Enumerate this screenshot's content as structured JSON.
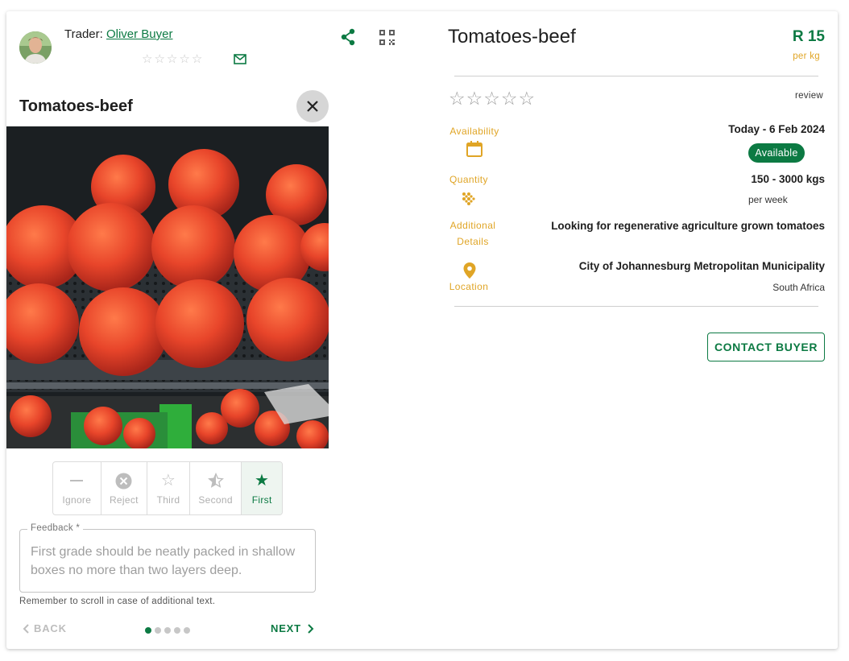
{
  "trader": {
    "prefix": "Trader:",
    "name": "Oliver Buyer"
  },
  "header_icons": [
    "share-icon",
    "qr-code-icon"
  ],
  "left_panel": {
    "product_title": "Tomatoes-beef",
    "grades": [
      {
        "label": "Ignore",
        "icon": "minus-icon"
      },
      {
        "label": "Reject",
        "icon": "reject-circle-icon"
      },
      {
        "label": "Third",
        "icon": "star-outline-icon"
      },
      {
        "label": "Second",
        "icon": "star-half-icon"
      },
      {
        "label": "First",
        "icon": "star-filled-icon"
      }
    ],
    "selected_grade": "First",
    "feedback_label": "Feedback *",
    "feedback_placeholder": "First grade should be neatly packed in shallow boxes no more than two layers deep.",
    "scroll_hint": "Remember to scroll in case of additional text.",
    "back_label": "BACK",
    "next_label": "NEXT",
    "page_count": 5,
    "current_page": 1
  },
  "right_panel": {
    "product_title": "Tomatoes-beef",
    "price": "R 15",
    "price_unit": "per kg",
    "review_label": "review",
    "availability_label": "Availability",
    "availability_value": "Today - 6 Feb 2024",
    "availability_badge": "Available",
    "quantity_label": "Quantity",
    "quantity_value": "150 - 3000 kgs",
    "quantity_unit": "per week",
    "additional_label_1": "Additional",
    "additional_label_2": "Details",
    "additional_value": "Looking for regenerative agriculture grown tomatoes",
    "location_label": "Location",
    "location_value": "City of Johannesburg Metropolitan Municipality",
    "location_country": "South Africa",
    "contact_label": "CONTACT BUYER"
  },
  "colors": {
    "brand_green": "#0c7a43",
    "accent_amber": "#e0a526",
    "star_grey": "#c9c9c9"
  }
}
